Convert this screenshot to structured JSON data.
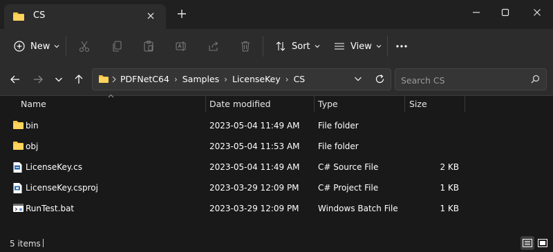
{
  "colors": {
    "folder": "#f5c542",
    "accent": "#4cc2ff"
  },
  "tab": {
    "title": "CS"
  },
  "toolbar": {
    "new_label": "New",
    "sort_label": "Sort",
    "view_label": "View"
  },
  "breadcrumb": [
    "PDFNetC64",
    "Samples",
    "LicenseKey",
    "CS"
  ],
  "search": {
    "placeholder": "Search CS"
  },
  "columns": {
    "name": "Name",
    "date": "Date modified",
    "type": "Type",
    "size": "Size"
  },
  "files": [
    {
      "name": "bin",
      "date": "2023-05-04 11:49 AM",
      "type": "File folder",
      "size": "",
      "icon": "folder-icon"
    },
    {
      "name": "obj",
      "date": "2023-05-04 11:53 AM",
      "type": "File folder",
      "size": "",
      "icon": "folder-icon"
    },
    {
      "name": "LicenseKey.cs",
      "date": "2023-05-04 11:49 AM",
      "type": "C# Source File",
      "size": "2 KB",
      "icon": "cs-file-icon"
    },
    {
      "name": "LicenseKey.csproj",
      "date": "2023-03-29 12:09 PM",
      "type": "C# Project File",
      "size": "1 KB",
      "icon": "csproj-file-icon"
    },
    {
      "name": "RunTest.bat",
      "date": "2023-03-29 12:09 PM",
      "type": "Windows Batch File",
      "size": "1 KB",
      "icon": "batch-file-icon"
    }
  ],
  "status": {
    "count": "5 items"
  }
}
